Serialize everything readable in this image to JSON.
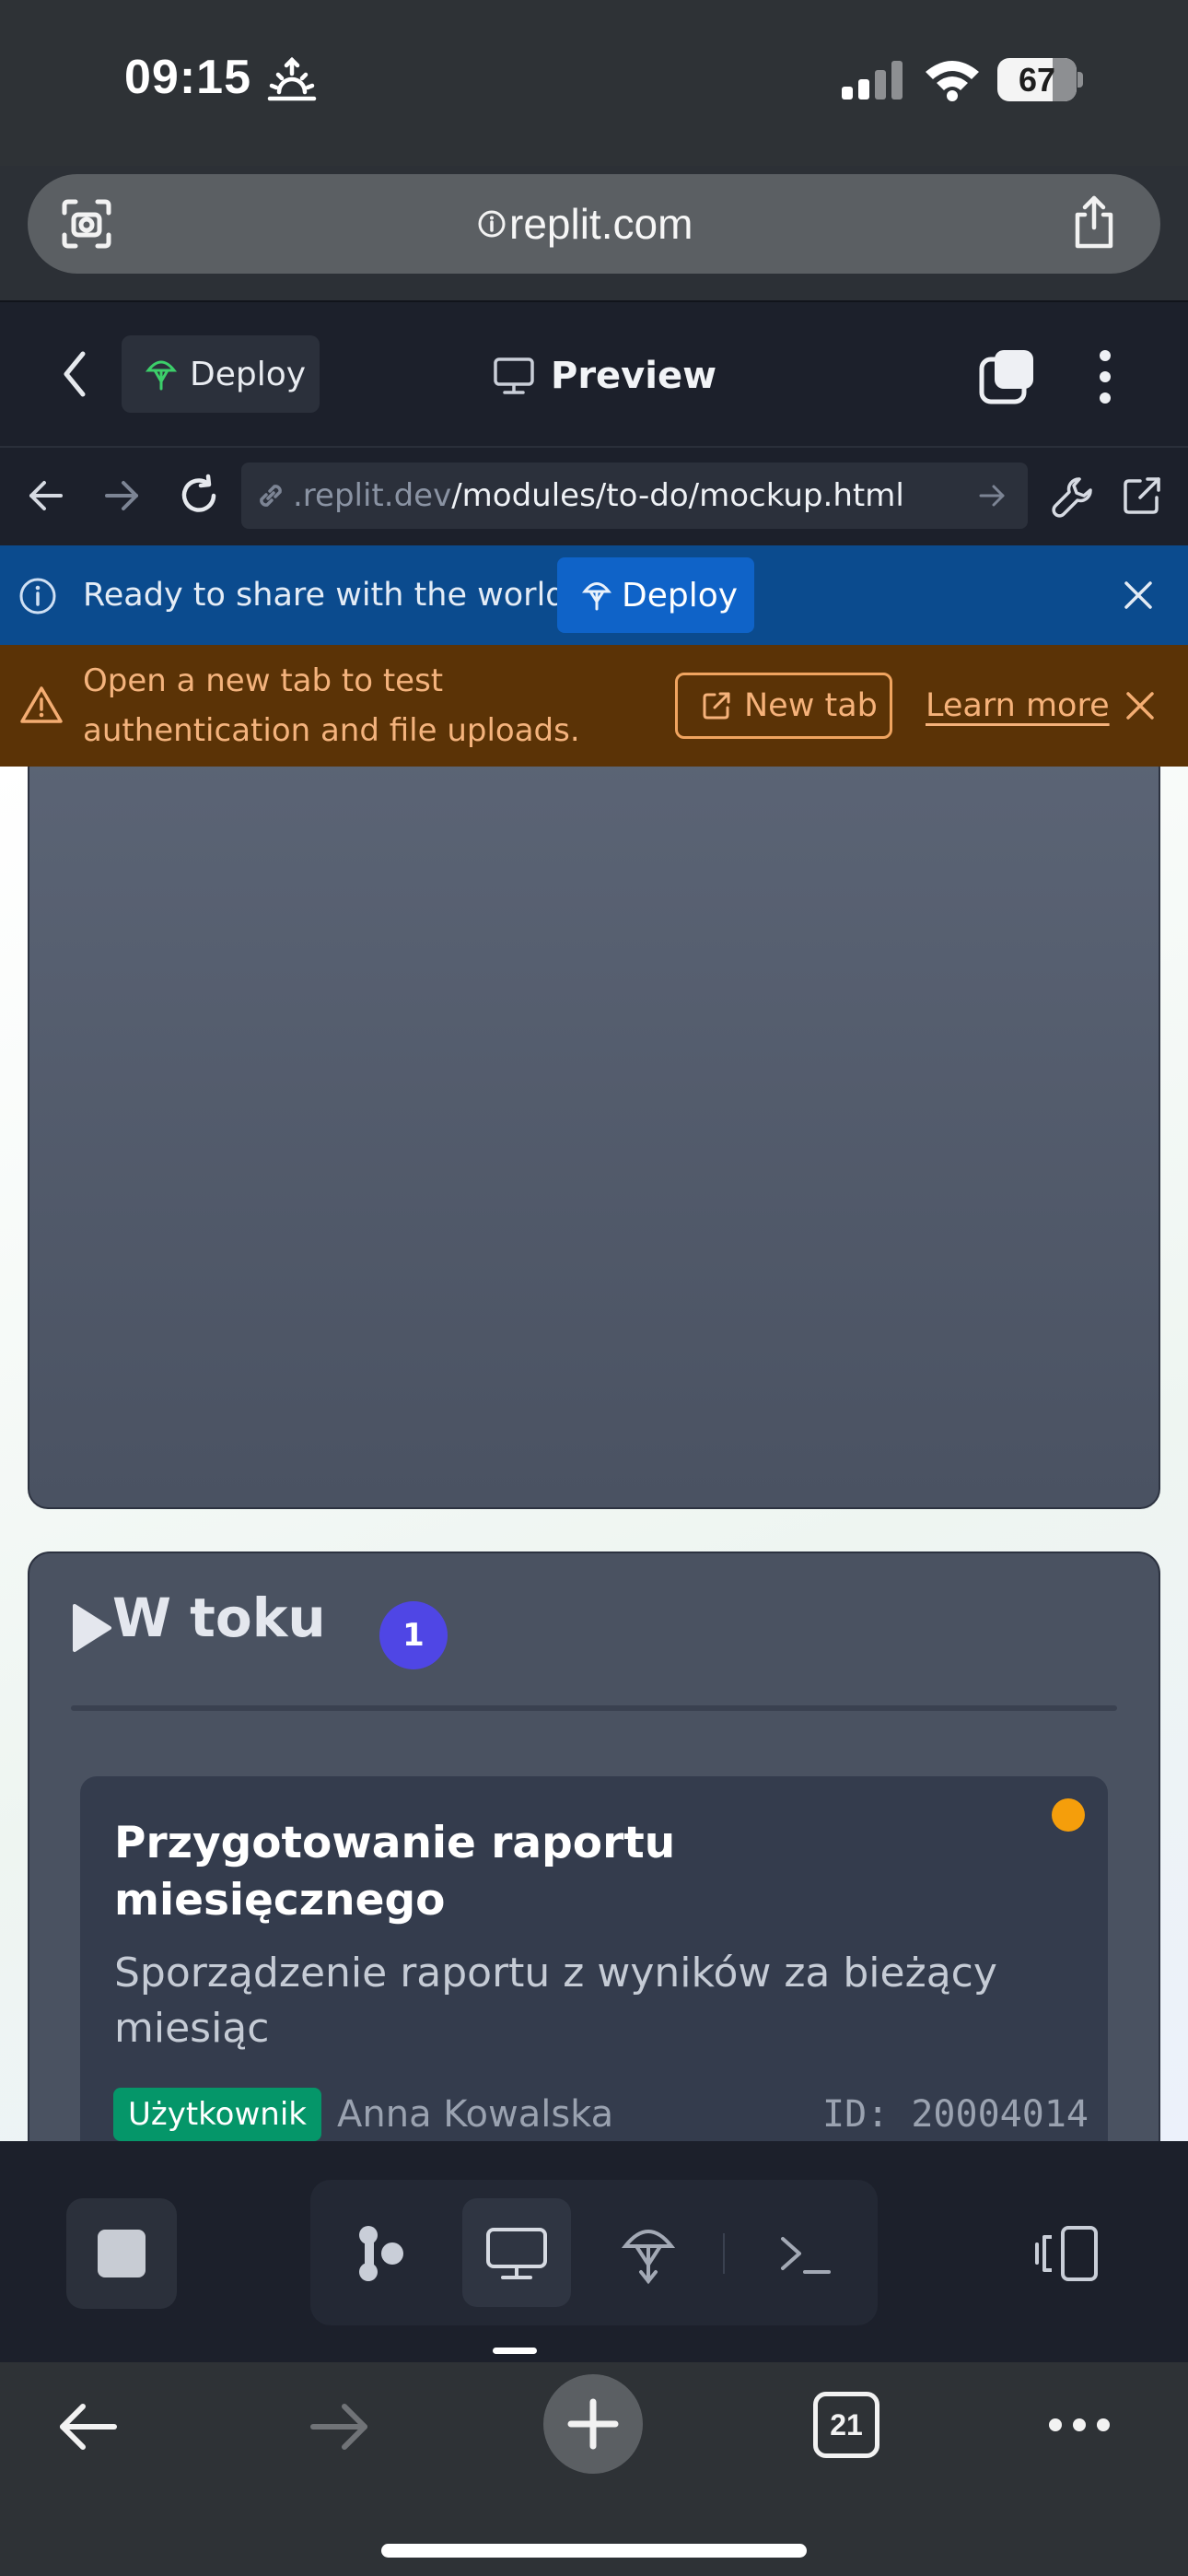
{
  "status_bar": {
    "time": "09:15",
    "battery": "67"
  },
  "safari": {
    "domain": "replit.com",
    "tab_count": "21"
  },
  "replit_header": {
    "deploy_label": "Deploy",
    "preview_label": "Preview"
  },
  "replit_nav": {
    "url_dim": ".replit.dev",
    "url_path": "/modules/to-do/mockup.html"
  },
  "deploy_banner": {
    "message": "Ready to share with the world?",
    "button_label": "Deploy"
  },
  "warning_banner": {
    "message": "Open a new tab to test authentication and file uploads.",
    "new_tab_label": "New tab",
    "learn_more_label": "Learn more"
  },
  "app": {
    "column": {
      "title": "W toku",
      "count": "1"
    },
    "task": {
      "title": "Przygotowanie raportu miesięcznego",
      "description": "Sporządzenie raportu z wyników za bieżący miesiąc",
      "role": "Użytkownik",
      "assignee": "Anna Kowalska",
      "id": "ID: 20004014",
      "priority_color": "#f59e0b"
    }
  },
  "colors": {
    "accent_indigo": "#4f46e5",
    "deploy_blue": "#0f63c8",
    "warning_orange": "#f6b27a",
    "role_green": "#059669"
  }
}
